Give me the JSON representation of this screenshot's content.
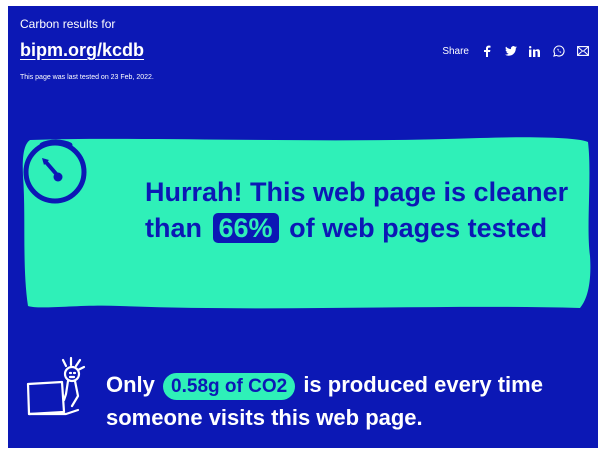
{
  "header": {
    "eyebrow": "Carbon results for",
    "site_url": "bipm.org/kcdb",
    "tested_note": "This page was last tested on 23 Feb, 2022."
  },
  "share": {
    "label": "Share",
    "icons": [
      "facebook-icon",
      "twitter-icon",
      "linkedin-icon",
      "whatsapp-icon",
      "email-icon"
    ]
  },
  "result": {
    "headline_before": "Hurrah! This web page is cleaner than",
    "percentage": "66%",
    "headline_after": "of web pages tested"
  },
  "emissions": {
    "before": "Only",
    "amount": "0.58g of CO2",
    "after": "is produced every time someone visits this web page."
  },
  "colors": {
    "background": "#0c18b5",
    "accent": "#2ff0b8",
    "text": "#ffffff"
  }
}
